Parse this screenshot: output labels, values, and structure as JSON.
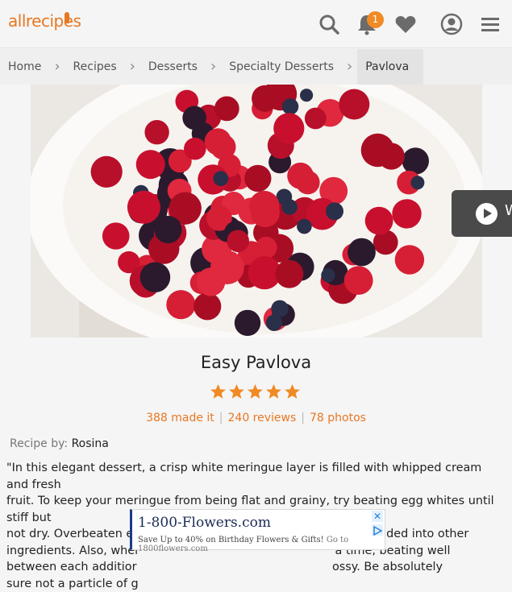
{
  "header": {
    "logo": "allrecipes",
    "notification_count": "1",
    "icons": [
      "search-icon",
      "bell-icon",
      "heart-icon",
      "user-icon",
      "menu-icon"
    ]
  },
  "breadcrumb": [
    "Home",
    "Recipes",
    "Desserts",
    "Specialty Desserts",
    "Pavlova"
  ],
  "video": {
    "label": "W"
  },
  "recipe": {
    "title": "Easy Pavlova",
    "rating": 5,
    "made_it": "388 made it",
    "reviews": "240 reviews",
    "photos": "78 photos",
    "recipe_by_label": "Recipe by:",
    "author": "Rosina",
    "description_lines": [
      "\"In this elegant dessert, a crisp white meringue layer is filled with whipped cream and fresh",
      "fruit. To keep your meringue from being flat and grainy, try beating egg whites until stiff but",
      "not dry. Overbeaten egg whites lose volume and deflate when folded into other",
      "ingredients. Also, wher                                                     a time, beating well",
      "between each additior                                                     ossy. Be absolutely",
      "sure not a particle of g"
    ]
  },
  "ad": {
    "title": "1-800-Flowers.com",
    "subtitle": "Save Up to 40% on Birthday Flowers & Gifts!",
    "source": "Go to 1800flowers.com",
    "close": "✕"
  },
  "colors": {
    "brand": "#e87722",
    "star": "#f08a24"
  }
}
